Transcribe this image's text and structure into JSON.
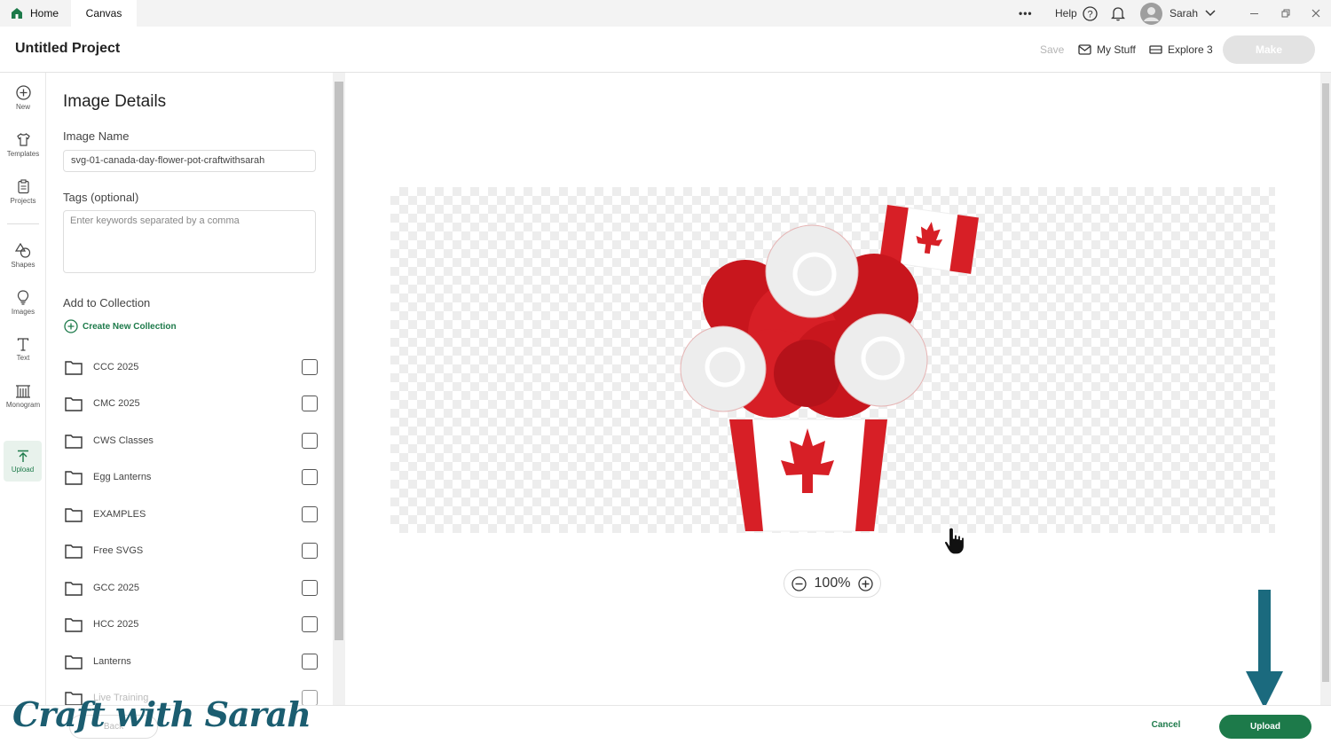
{
  "topbar": {
    "tabs": [
      {
        "label": "Home",
        "icon": "house-icon"
      },
      {
        "label": "Canvas"
      }
    ],
    "more_label": "•••",
    "help_label": "Help",
    "user_name": "Sarah"
  },
  "header": {
    "project_title": "Untitled Project",
    "save_label": "Save",
    "mystuff_label": "My Stuff",
    "machine_label": "Explore 3",
    "make_label": "Make"
  },
  "leftnav": {
    "items": [
      {
        "label": "New",
        "icon": "plus-circle-icon"
      },
      {
        "label": "Templates",
        "icon": "shirt-icon"
      },
      {
        "label": "Projects",
        "icon": "clipboard-icon"
      },
      {
        "label": "Shapes",
        "icon": "shapes-icon"
      },
      {
        "label": "Images",
        "icon": "lightbulb-icon"
      },
      {
        "label": "Text",
        "icon": "text-icon"
      },
      {
        "label": "Monogram",
        "icon": "monogram-icon"
      },
      {
        "label": "Upload",
        "icon": "upload-icon",
        "active": true
      }
    ]
  },
  "panel": {
    "title": "Image Details",
    "image_name_label": "Image Name",
    "image_name_value": "svg-01-canada-day-flower-pot-craftwithsarah",
    "tags_label": "Tags (optional)",
    "tags_placeholder": "Enter keywords separated by a comma",
    "collection_label": "Add to Collection",
    "create_collection_label": "Create New Collection",
    "collections": [
      {
        "name": "CCC 2025",
        "checked": false
      },
      {
        "name": "CMC 2025",
        "checked": false
      },
      {
        "name": "CWS Classes",
        "checked": false
      },
      {
        "name": "Egg Lanterns",
        "checked": false
      },
      {
        "name": "EXAMPLES",
        "checked": false
      },
      {
        "name": "Free SVGS",
        "checked": false
      },
      {
        "name": "GCC 2025",
        "checked": false
      },
      {
        "name": "HCC 2025",
        "checked": false
      },
      {
        "name": "Lanterns",
        "checked": false
      },
      {
        "name": "Live Training",
        "checked": false
      }
    ]
  },
  "canvas": {
    "zoom": "100%"
  },
  "footer": {
    "back_label": "Back",
    "cancel_label": "Cancel",
    "upload_label": "Upload"
  },
  "watermark": "Craft with Sarah",
  "colors": {
    "brand_green": "#1d7a4a",
    "flag_red": "#d71f26",
    "arrow_teal": "#1b6a7e"
  }
}
